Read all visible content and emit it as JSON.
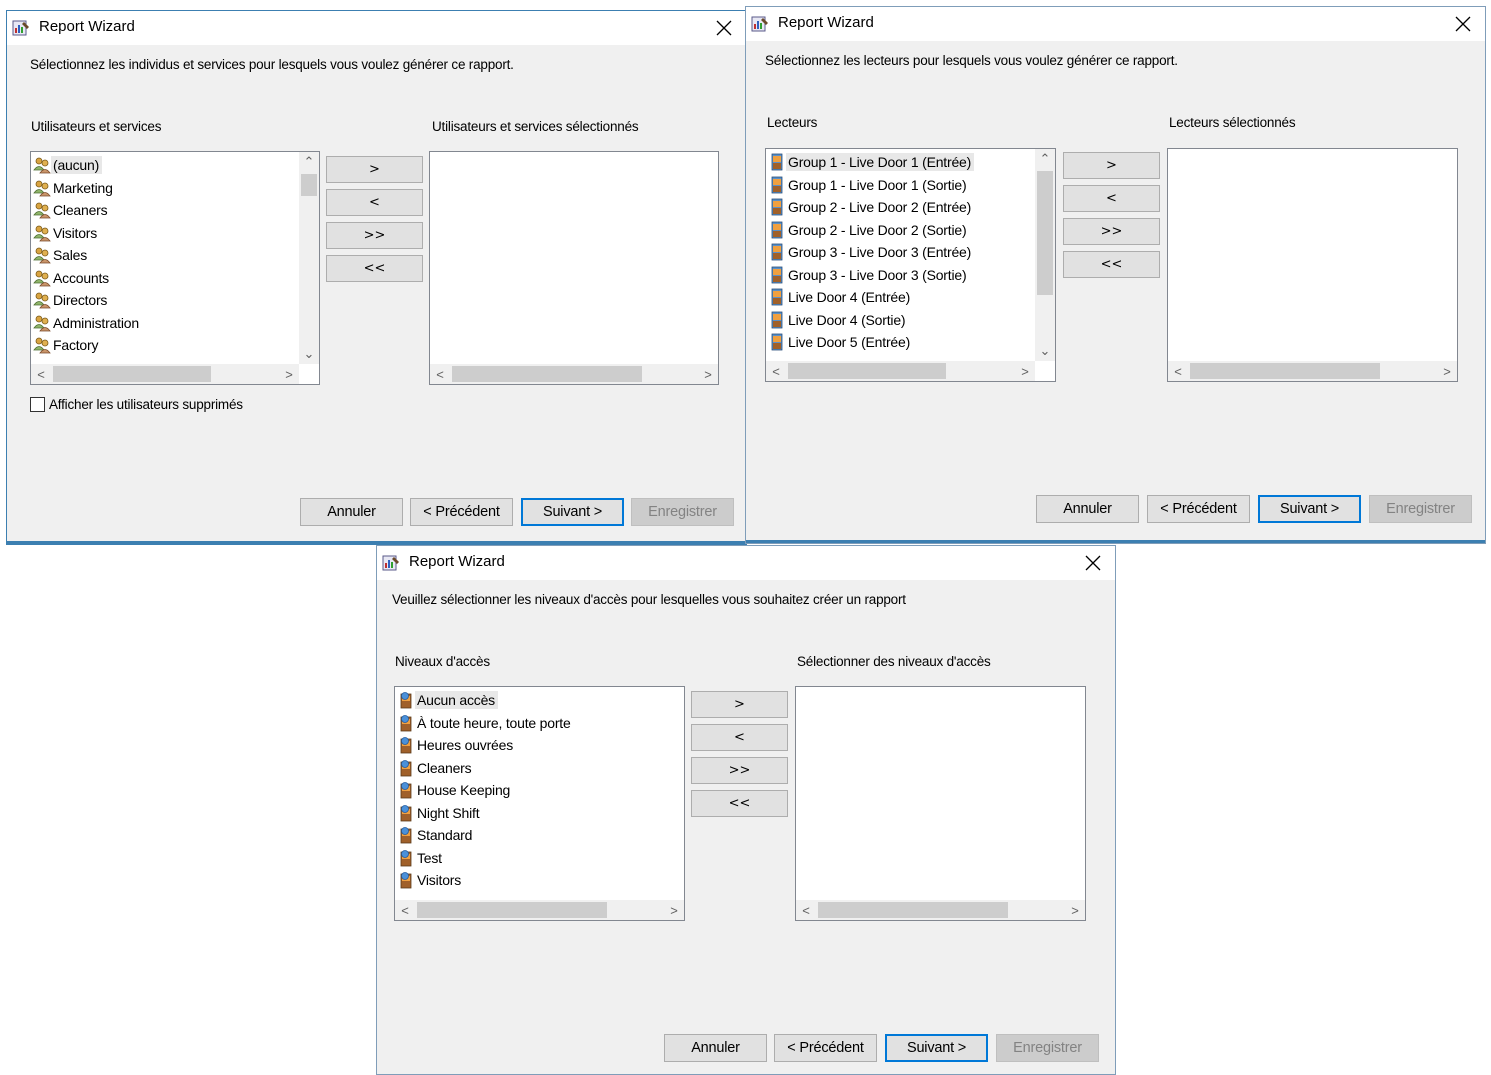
{
  "dialog1": {
    "title": "Report Wizard",
    "instruction": "Sélectionnez les individus et services pour lesquels vous voulez générer ce rapport.",
    "left_label": "Utilisateurs et services",
    "right_label": "Utilisateurs et services sélectionnés",
    "items": [
      {
        "label": "(aucun)"
      },
      {
        "label": "Marketing"
      },
      {
        "label": "Cleaners"
      },
      {
        "label": "Visitors"
      },
      {
        "label": "Sales"
      },
      {
        "label": "Accounts"
      },
      {
        "label": "Directors"
      },
      {
        "label": "Administration"
      },
      {
        "label": "Factory"
      }
    ],
    "item_icon": "user-group-icon",
    "selected_index": 0,
    "checkbox_label": "Afficher les utilisateurs supprimés",
    "checkbox_checked": false
  },
  "dialog2": {
    "title": "Report Wizard",
    "instruction": "Sélectionnez les lecteurs pour lesquels vous voulez générer ce rapport.",
    "left_label": "Lecteurs",
    "right_label": "Lecteurs sélectionnés",
    "items": [
      {
        "label": "Group 1 - Live Door 1 (Entrée)"
      },
      {
        "label": "Group 1 - Live Door 1 (Sortie)"
      },
      {
        "label": "Group 2 - Live Door 2 (Entrée)"
      },
      {
        "label": "Group 2 - Live Door 2 (Sortie)"
      },
      {
        "label": "Group 3 - Live Door 3 (Entrée)"
      },
      {
        "label": "Group 3 - Live Door 3 (Sortie)"
      },
      {
        "label": "Live Door 4 (Entrée)"
      },
      {
        "label": "Live Door 4 (Sortie)"
      },
      {
        "label": "Live Door 5 (Entrée)"
      }
    ],
    "item_icon": "door-icon",
    "selected_index": 0
  },
  "dialog3": {
    "title": "Report Wizard",
    "instruction": "Veuillez sélectionner les niveaux d'accès pour lesquelles vous souhaitez créer un rapport",
    "left_label": "Niveaux d'accès",
    "right_label": "Sélectionner des niveaux d'accès",
    "items": [
      {
        "label": "Aucun accès"
      },
      {
        "label": "À toute heure, toute porte"
      },
      {
        "label": "Heures ouvrées"
      },
      {
        "label": "Cleaners"
      },
      {
        "label": "House Keeping"
      },
      {
        "label": "Night Shift"
      },
      {
        "label": "Standard"
      },
      {
        "label": "Test"
      },
      {
        "label": "Visitors"
      }
    ],
    "item_icon": "access-level-icon",
    "selected_index": 0
  },
  "move_buttons": {
    "add": ">",
    "remove": "<",
    "add_all": ">>",
    "remove_all": "<<"
  },
  "buttons": {
    "cancel": "Annuler",
    "previous": "< Précédent",
    "next": "Suivant >",
    "save": "Enregistrer"
  },
  "colors": {
    "accent": "#0078d7",
    "dialog_bg": "#f0f0f0",
    "disabled_text": "#838383"
  }
}
